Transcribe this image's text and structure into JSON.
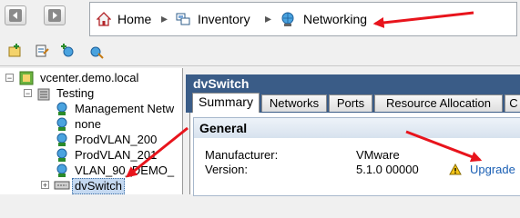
{
  "breadcrumb": {
    "home": "Home",
    "inventory": "Inventory",
    "networking": "Networking",
    "separator": "▸"
  },
  "tree": {
    "root": "vcenter.demo.local",
    "datacenter": "Testing",
    "items": [
      "Management Netw",
      "none",
      "ProdVLAN_200",
      "ProdVLAN_201",
      "VLAN_90_DEMO_"
    ],
    "selected": "dvSwitch",
    "expander_open": "−",
    "expander_closed": "+"
  },
  "pane": {
    "title": "dvSwitch",
    "tabs": [
      "Summary",
      "Networks",
      "Ports",
      "Resource Allocation",
      "C"
    ],
    "active_tab": "Summary"
  },
  "general": {
    "heading": "General",
    "manufacturer_label": "Manufacturer:",
    "manufacturer_value": "VMware",
    "version_label": "Version:",
    "version_value": "5.1.0 00000",
    "upgrade_label": "Upgrade"
  },
  "colors": {
    "arrow": "#e8141c",
    "pane_header": "#3a5c87",
    "link": "#1a5fb4"
  },
  "icons": [
    "back-arrow-icon",
    "forward-arrow-icon",
    "home-icon",
    "inventory-icon",
    "networking-globe-icon",
    "warning-icon"
  ]
}
